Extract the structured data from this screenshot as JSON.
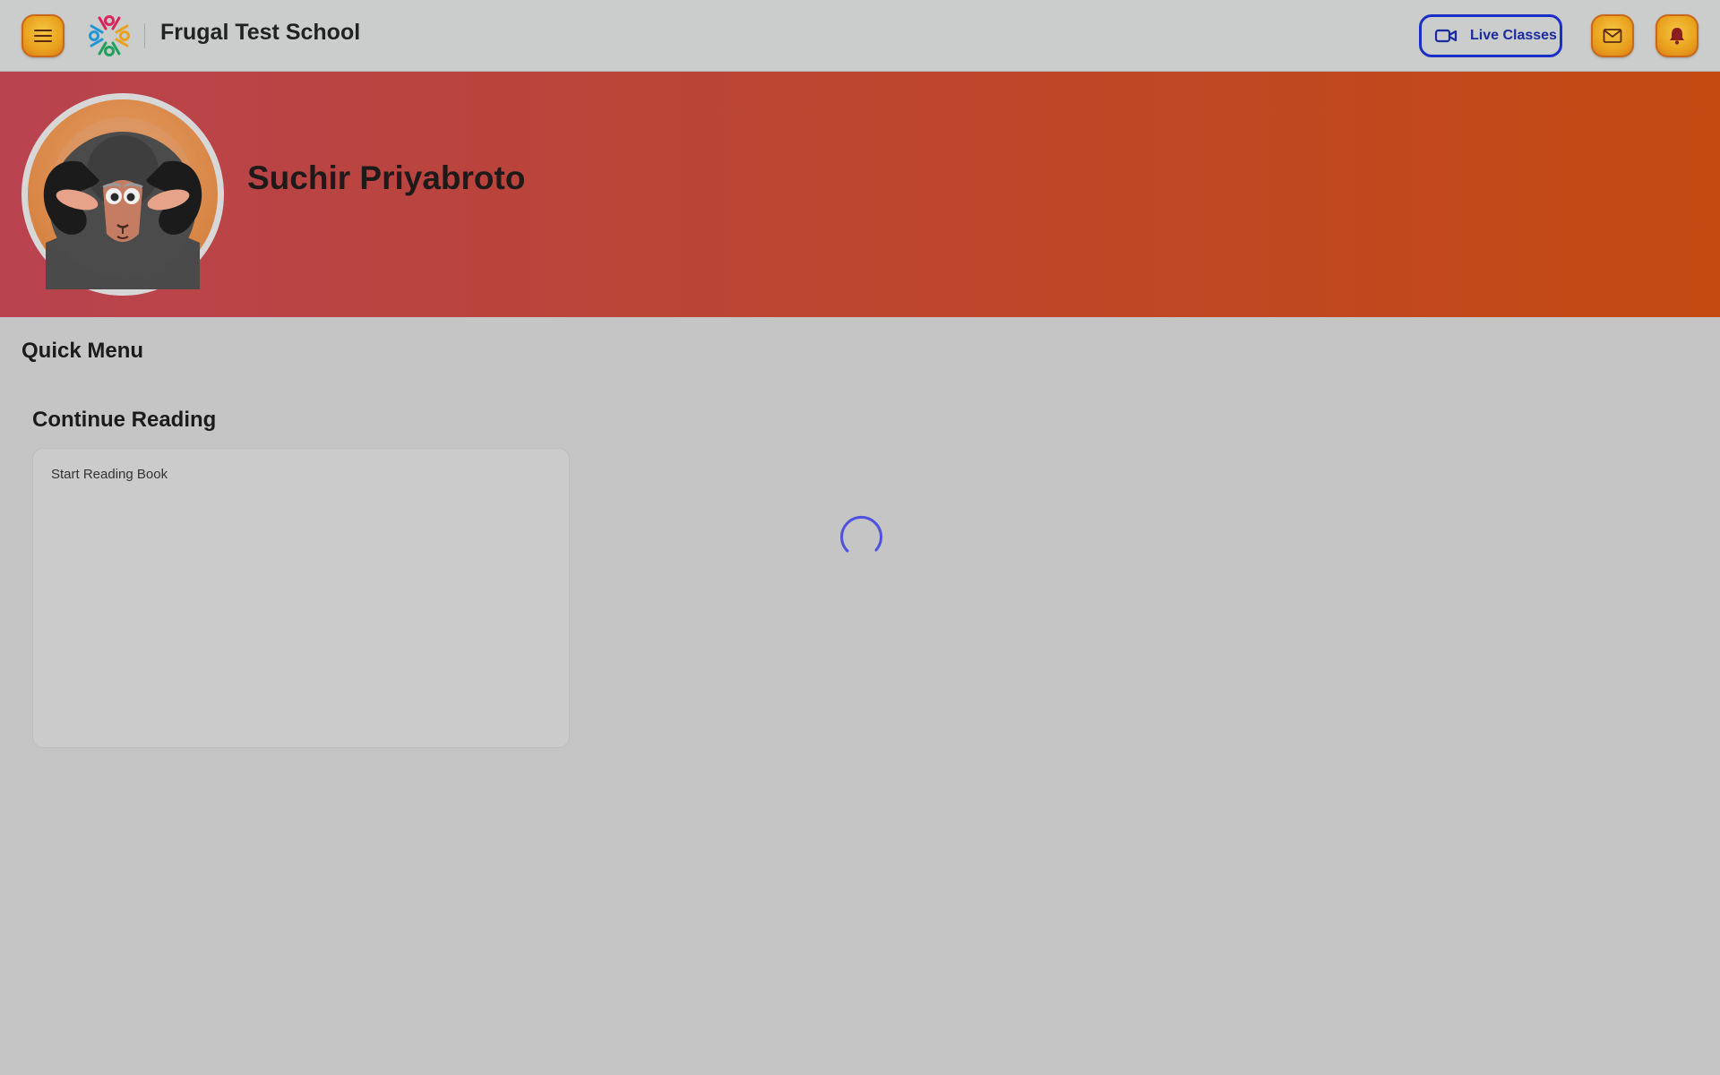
{
  "header": {
    "school_name": "Frugal Test School",
    "live_classes_label": "Live Classes",
    "icons": {
      "menu": "hamburger-menu-icon",
      "logo": "school-logo",
      "live": "video-camera-icon",
      "mail": "mail-icon",
      "notifications": "bell-icon"
    }
  },
  "profile": {
    "name": "Suchir Priyabroto",
    "avatar": "ram-avatar"
  },
  "quick_menu": {
    "title": "Quick Menu"
  },
  "continue_reading": {
    "title": "Continue Reading",
    "card_text": "Start Reading Book"
  },
  "colors": {
    "accent_orange": "#e9a21e",
    "live_button_blue": "#1a2fc8",
    "banner_start": "#b9434f",
    "banner_end": "#c44a12",
    "spinner": "#4f52e0"
  }
}
